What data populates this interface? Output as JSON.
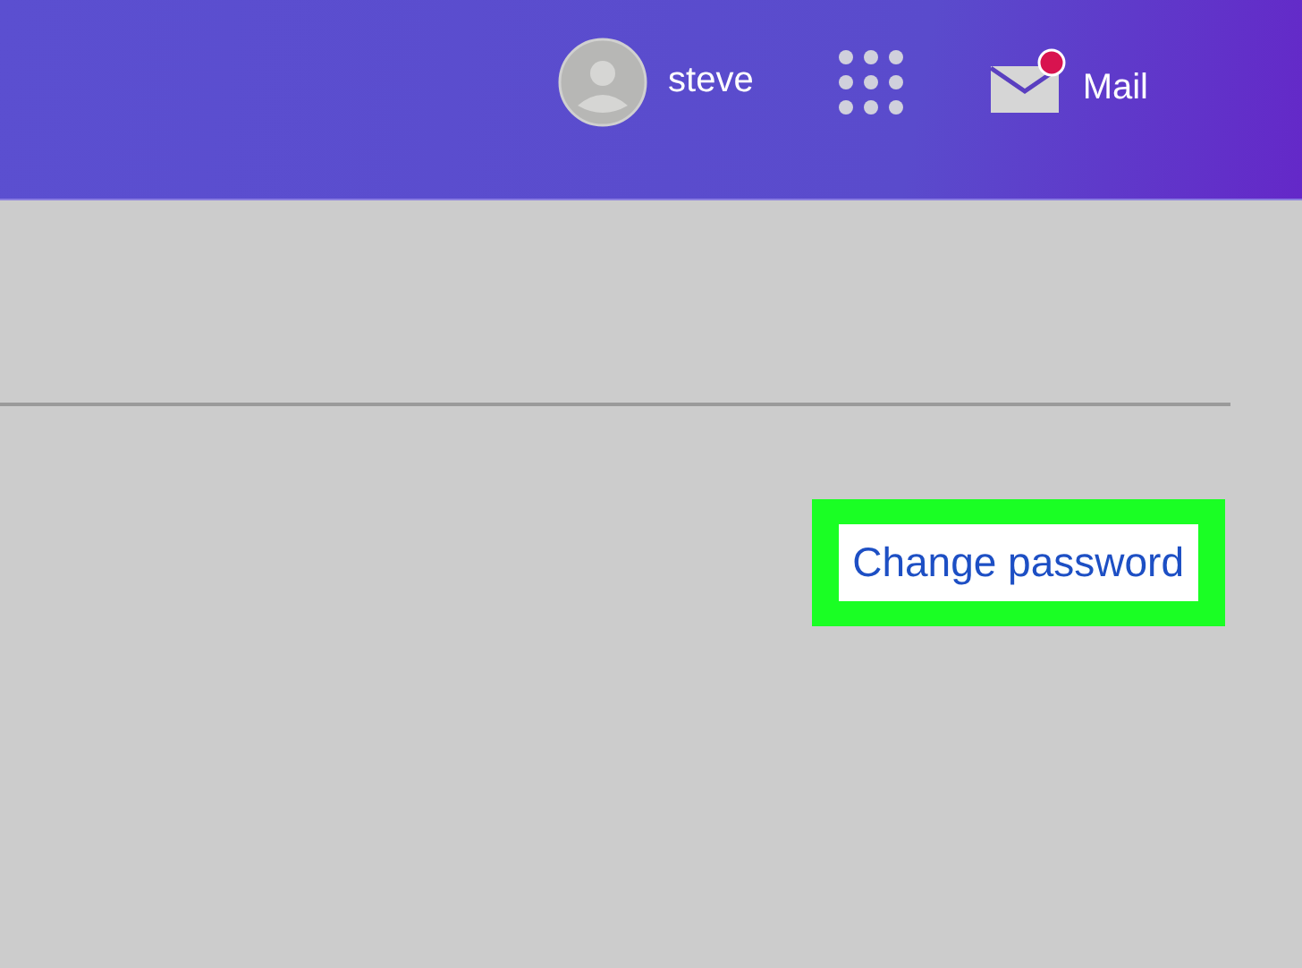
{
  "header": {
    "user": {
      "name": "steve"
    },
    "mail": {
      "label": "Mail",
      "unread": true
    }
  },
  "account": {
    "link": {
      "label": "Change password",
      "highlighted": true
    }
  }
}
